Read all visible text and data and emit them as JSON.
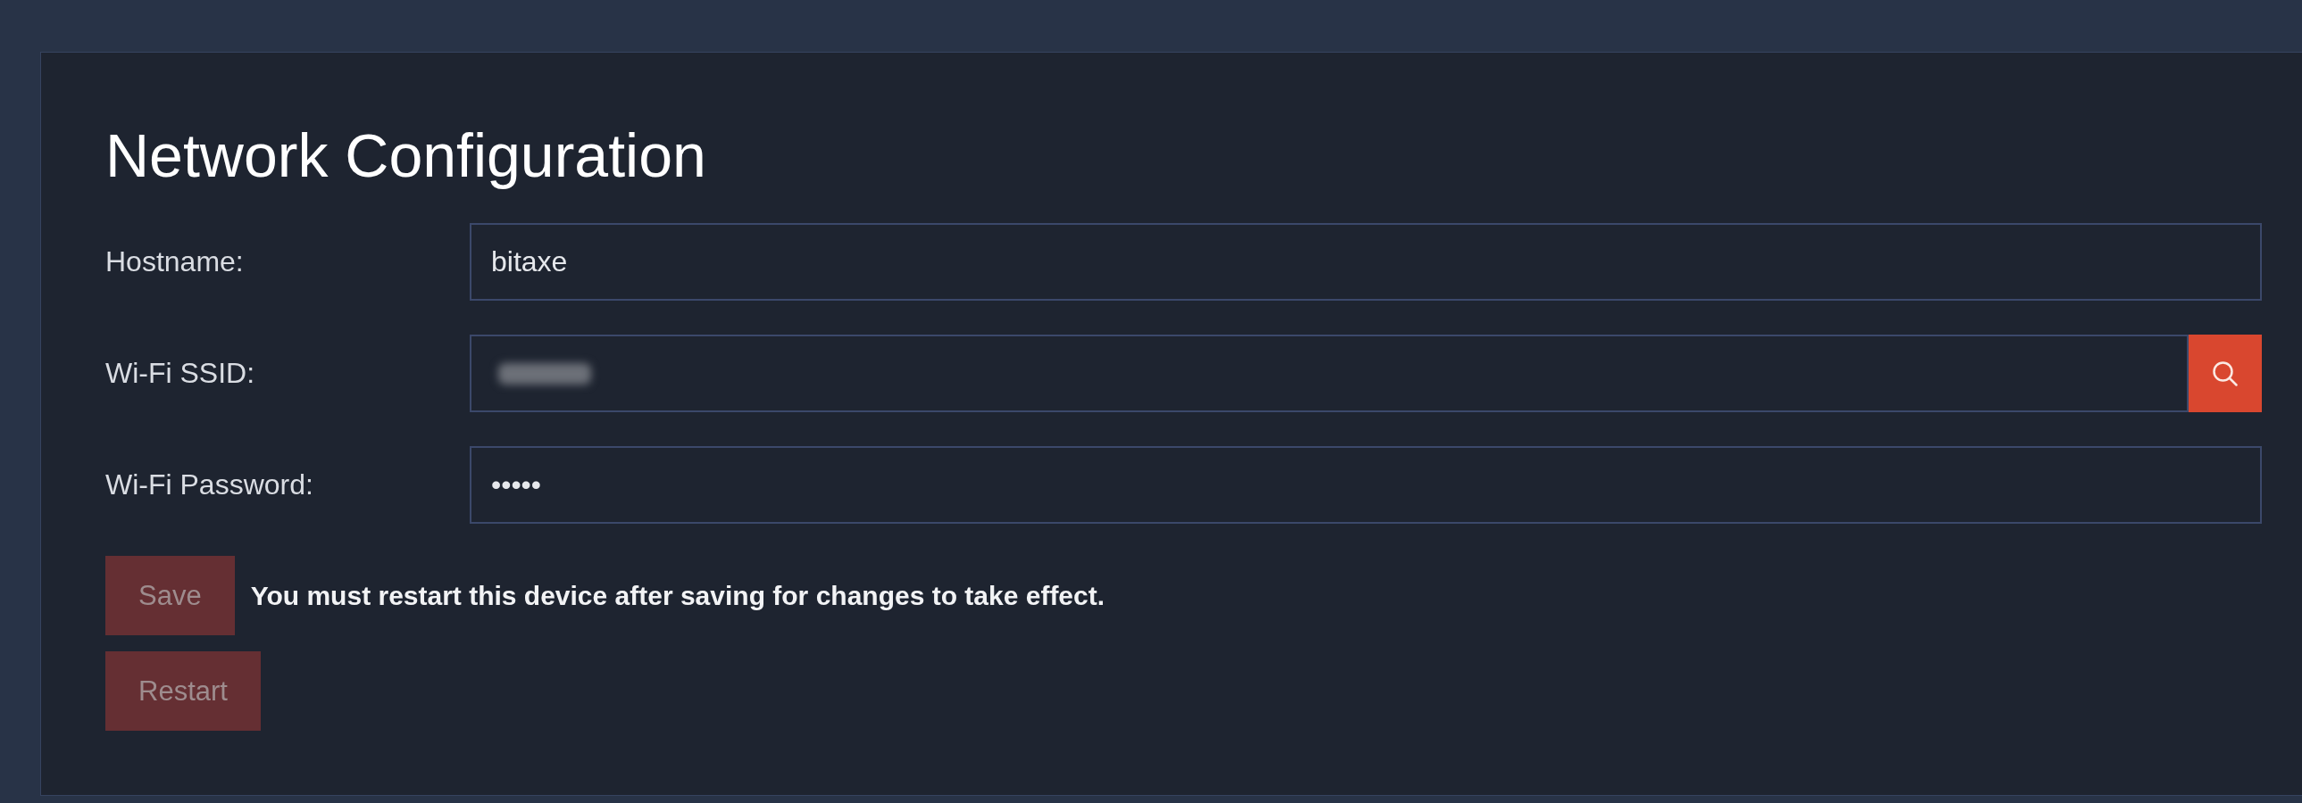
{
  "card": {
    "title": "Network Configuration"
  },
  "fields": [
    {
      "label": "Hostname:",
      "value": "bitaxe",
      "redacted": false,
      "search_button": false
    },
    {
      "label": "Wi-Fi SSID:",
      "redacted": true,
      "search_button": true
    },
    {
      "label": "Wi-Fi Password:",
      "value": "•••••",
      "redacted": false,
      "search_button": false
    }
  ],
  "actions": [
    {
      "label": "Save",
      "disabled": true,
      "note": "You must restart this device after saving for changes to take effect."
    },
    {
      "label": "Restart",
      "disabled": true
    }
  ]
}
